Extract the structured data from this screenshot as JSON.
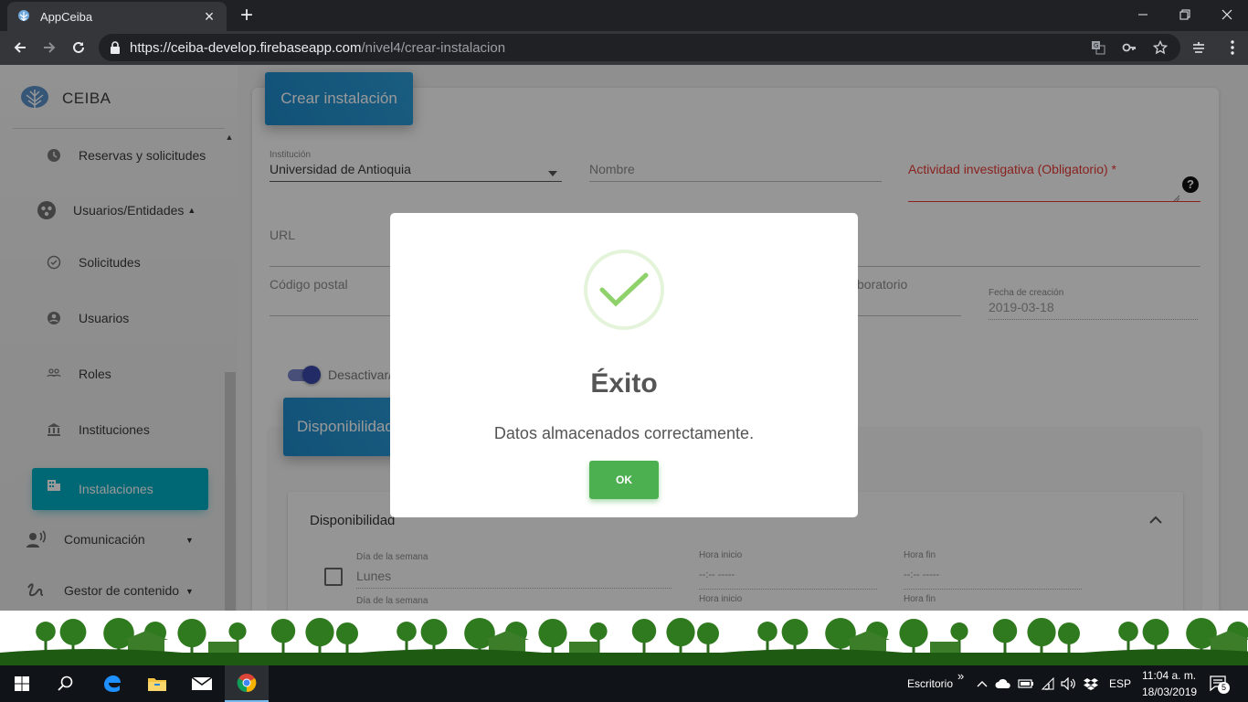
{
  "browser": {
    "tab_title": "AppCeiba",
    "close_symbol": "×",
    "new_tab_symbol": "+",
    "url_host": "https://ceiba-develop.firebaseapp.com",
    "url_path": "/nivel4/crear-instalacion"
  },
  "sidebar": {
    "brand": "CEIBA",
    "items": [
      {
        "label": "Reservas y solicitudes",
        "icon": "schedule-icon"
      },
      {
        "label": "Usuarios/Entidades",
        "icon": "group-icon"
      },
      {
        "label": "Solicitudes",
        "icon": "check-circle-icon"
      },
      {
        "label": "Usuarios",
        "icon": "account-circle-icon"
      },
      {
        "label": "Roles",
        "icon": "people-icon"
      },
      {
        "label": "Instituciones",
        "icon": "bank-icon"
      },
      {
        "label": "Instalaciones",
        "icon": "building-icon"
      },
      {
        "label": "Comunicación",
        "icon": "record-voice-icon"
      },
      {
        "label": "Gestor de contenido",
        "icon": "gesture-icon"
      }
    ]
  },
  "form": {
    "header": "Crear instalación",
    "institucion_label": "Institución",
    "institucion_value": "Universidad de Antioquia",
    "nombre_placeholder": "Nombre",
    "actividad_placeholder": "Actividad investigativa (Obligatorio) *",
    "url_placeholder": "URL",
    "codigo_postal_placeholder": "Código postal",
    "laboratorio_placeholder": "boratorio",
    "fecha_label": "Fecha de creación",
    "fecha_value": "2019-03-18",
    "toggle_label": "Desactivar/",
    "disponibilidad_button": "Disponibilidad",
    "panel_title": "Disponibilidad",
    "dia_label": "Día de la semana",
    "dia_value": "Lunes",
    "hora_inicio_label": "Hora inicio",
    "hora_fin_label": "Hora fin",
    "time_placeholder": "--:-- -----"
  },
  "modal": {
    "title": "Éxito",
    "message": "Datos almacenados correctamente.",
    "ok_label": "OK",
    "accent": "#4caf50"
  },
  "taskbar": {
    "desktop_label": "Escritorio",
    "chevron": "»",
    "language": "ESP",
    "time": "11:04 a. m.",
    "date": "18/03/2019",
    "notifications": "5"
  }
}
